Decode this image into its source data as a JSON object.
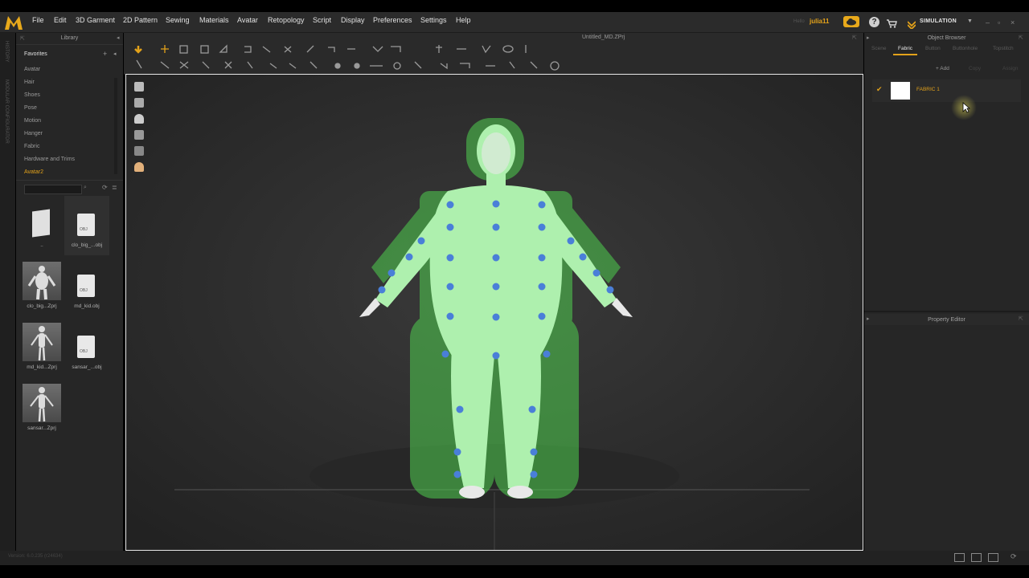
{
  "app": {
    "name": "Marvelous Designer",
    "logo_letter": "M"
  },
  "menu": [
    "File",
    "Edit",
    "3D Garment",
    "2D Pattern",
    "Sewing",
    "Materials",
    "Avatar",
    "Retopology",
    "Script",
    "Display",
    "Preferences",
    "Settings",
    "Help"
  ],
  "user": {
    "greeting": "Hello",
    "name": "julia11"
  },
  "mode": {
    "label": "SIMULATION",
    "accent": "#e3a21a"
  },
  "library": {
    "title": "Library",
    "favorites_label": "Favorites",
    "items": [
      "Avatar",
      "Hair",
      "Shoes",
      "Pose",
      "Motion",
      "Hanger",
      "Fabric",
      "Hardware and Trims",
      "Avatar2"
    ],
    "active_item": "Avatar2",
    "files": [
      {
        "label": "..",
        "kind": "folder"
      },
      {
        "label": "clo_big_...obj",
        "kind": "obj",
        "badge": "OBJ"
      },
      {
        "label": "clo_big...Zprj",
        "kind": "avatar"
      },
      {
        "label": "md_kid.obj",
        "kind": "obj",
        "badge": "OBJ"
      },
      {
        "label": "md_kid...Zprj",
        "kind": "avatar"
      },
      {
        "label": "sansar_...obj",
        "kind": "obj",
        "badge": "OBJ"
      },
      {
        "label": "sansar...Zprj",
        "kind": "avatar"
      }
    ]
  },
  "left_strip": {
    "history": "HISTORY",
    "configurator": "MODULAR CONFIGURATOR"
  },
  "viewport": {
    "document_title": "Untitled_MD.ZPrj"
  },
  "object_browser": {
    "title": "Object Browser",
    "tabs": [
      "Scene",
      "Fabric",
      "Button",
      "Buttonhole",
      "Topstitch"
    ],
    "active_tab": "Fabric",
    "actions": [
      "+ Add",
      "Copy",
      "Assign"
    ],
    "fabric": {
      "name": "FABRIC 1",
      "color": "#ffffff",
      "checked": true
    }
  },
  "property_editor": {
    "title": "Property Editor"
  },
  "status": {
    "version": "Version: 6.0.235 (r24634)"
  },
  "colors": {
    "avatar_green": "#6fd06f",
    "point_blue": "#4a7fd8",
    "selection_accent": "#e3a21a"
  }
}
